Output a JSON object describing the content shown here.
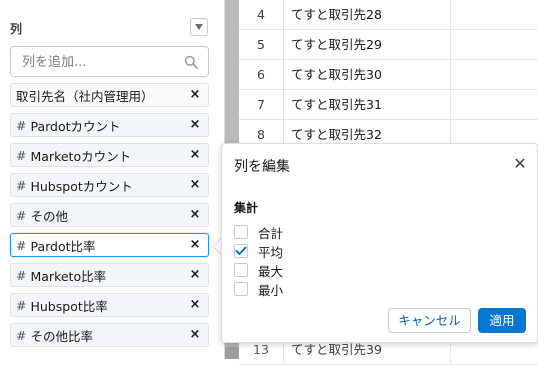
{
  "columns_panel": {
    "title": "列",
    "search_placeholder": "列を追加...",
    "remove_symbol": "×",
    "hash_symbol": "#",
    "items": [
      {
        "label": "取引先名（社内管理用）",
        "numeric": false
      },
      {
        "label": "Pardotカウント",
        "numeric": true
      },
      {
        "label": "Marketoカウント",
        "numeric": true
      },
      {
        "label": "Hubspotカウント",
        "numeric": true
      },
      {
        "label": "その他",
        "numeric": true
      },
      {
        "label": "Pardot比率",
        "numeric": true
      },
      {
        "label": "Marketo比率",
        "numeric": true
      },
      {
        "label": "Hubspot比率",
        "numeric": true
      },
      {
        "label": "その他比率",
        "numeric": true
      }
    ]
  },
  "table": {
    "rows": [
      {
        "num": "4",
        "name": "てすと取引先28"
      },
      {
        "num": "5",
        "name": "てすと取引先29"
      },
      {
        "num": "6",
        "name": "てすと取引先30"
      },
      {
        "num": "7",
        "name": "てすと取引先31"
      },
      {
        "num": "8",
        "name": "てすと取引先32"
      }
    ],
    "partial_row": {
      "num": "13",
      "name": "てすと取引先39"
    }
  },
  "edit_popover": {
    "title": "列を編集",
    "close_symbol": "✕",
    "section_label": "集計",
    "options": [
      {
        "label": "合計",
        "checked": false
      },
      {
        "label": "平均",
        "checked": true
      },
      {
        "label": "最大",
        "checked": false
      },
      {
        "label": "最小",
        "checked": false
      }
    ],
    "cancel_label": "キャンセル",
    "apply_label": "適用"
  },
  "colors": {
    "accent": "#0176d3",
    "active_border": "#1b96ff",
    "divider": "#b9b9b9"
  }
}
